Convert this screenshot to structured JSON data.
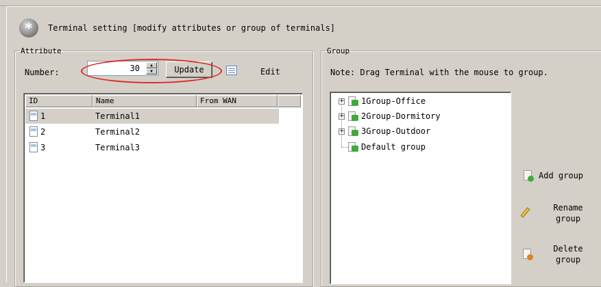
{
  "title": {
    "text": "Terminal setting [modify attributes or group of terminals]",
    "icon": "asterisk-icon",
    "icon_glyph": "*"
  },
  "attribute": {
    "legend": "Attribute",
    "number_label": "Number:",
    "number_value": "30",
    "update_label": "Update",
    "edit_label": "Edit",
    "highlight_color": "#e02828",
    "columns": [
      "ID",
      "Name",
      "From WAN"
    ],
    "rows": [
      {
        "id": "1",
        "name": "Terminal1",
        "from_wan": "",
        "selected": true
      },
      {
        "id": "2",
        "name": "Terminal2",
        "from_wan": "",
        "selected": false
      },
      {
        "id": "3",
        "name": "Terminal3",
        "from_wan": "",
        "selected": false
      }
    ]
  },
  "group": {
    "legend": "Group",
    "note": "Note: Drag Terminal with the mouse to group.",
    "tree": [
      {
        "label": "1Group-Office",
        "expandable": true
      },
      {
        "label": "2Group-Dormitory",
        "expandable": true
      },
      {
        "label": "3Group-Outdoor",
        "expandable": true
      },
      {
        "label": "Default group",
        "expandable": false
      }
    ],
    "expand_glyph": "+",
    "actions": {
      "add_label": "Add group",
      "rename_line1": "Rename",
      "rename_line2": "group",
      "delete_line1": "Delete",
      "delete_line2": "group"
    },
    "colors": {
      "add_badge": "#3fa83f",
      "delete_badge": "#e08020"
    }
  }
}
